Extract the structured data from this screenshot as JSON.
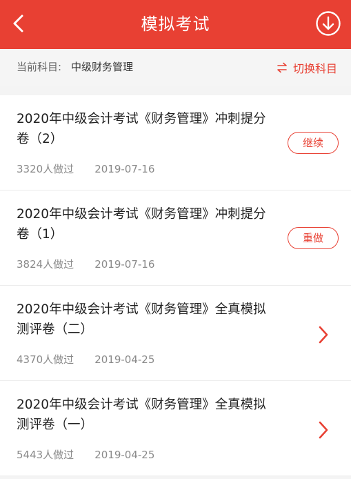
{
  "header": {
    "title": "模拟考试",
    "back_icon": "chevron-left-icon",
    "download_icon": "download-circle-icon"
  },
  "subject_bar": {
    "label": "当前科目:",
    "value": "中级财务管理",
    "switch_label": "切换科目",
    "switch_icon": "swap-arrows-icon"
  },
  "colors": {
    "accent": "#e84033",
    "background": "#f4f4f4",
    "meta_text": "#8a8a8a"
  },
  "exams": [
    {
      "title": "2020年中级会计考试《财务管理》冲刺提分卷（2）",
      "count": "3320人做过",
      "date": "2019-07-16",
      "action": "继续"
    },
    {
      "title": "2020年中级会计考试《财务管理》冲刺提分卷（1）",
      "count": "3824人做过",
      "date": "2019-07-16",
      "action": "重做"
    },
    {
      "title": "2020年中级会计考试《财务管理》全真模拟测评卷（二）",
      "count": "4370人做过",
      "date": "2019-04-25",
      "action": ""
    },
    {
      "title": "2020年中级会计考试《财务管理》全真模拟测评卷（一）",
      "count": "5443人做过",
      "date": "2019-04-25",
      "action": ""
    }
  ]
}
